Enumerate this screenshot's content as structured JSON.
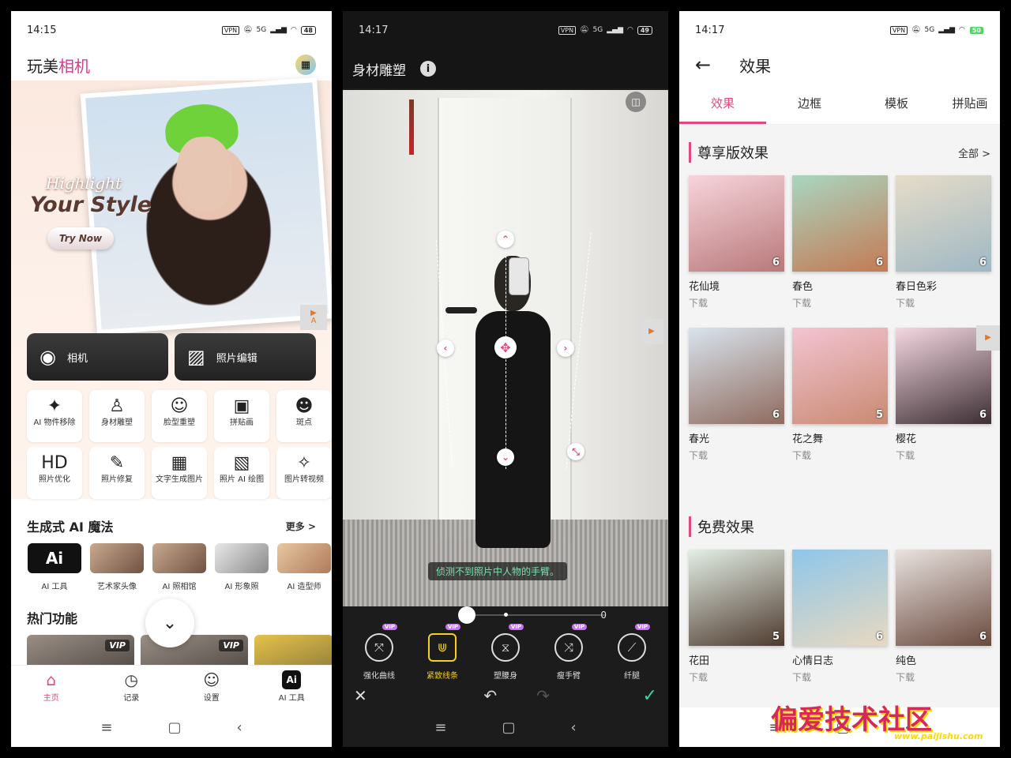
{
  "screen1": {
    "status": {
      "time": "14:15",
      "vpn": "VPN",
      "net": "5G",
      "battery": "48"
    },
    "app_title_a": "玩美",
    "app_title_b": "相机",
    "hero": {
      "line1": "Highlight",
      "line2": "Your Style",
      "cta": "Try Now",
      "side_badge": "A"
    },
    "big_buttons": [
      {
        "label": "相机",
        "icon": "camera-icon"
      },
      {
        "label": "照片编辑",
        "icon": "image-icon"
      }
    ],
    "tools": [
      {
        "label": "AI 物件移除",
        "icon": "eraser-icon",
        "glyph": "✦"
      },
      {
        "label": "身材雕塑",
        "icon": "body-icon",
        "glyph": "♙"
      },
      {
        "label": "脸型重塑",
        "icon": "face-icon",
        "glyph": "☺"
      },
      {
        "label": "拼贴画",
        "icon": "collage-icon",
        "glyph": "▣"
      },
      {
        "label": "斑点",
        "icon": "spot-icon",
        "glyph": "☻"
      },
      {
        "label": "照片优化",
        "icon": "hd-icon",
        "glyph": "HD"
      },
      {
        "label": "照片修复",
        "icon": "repair-icon",
        "glyph": "✎"
      },
      {
        "label": "文字生成图片",
        "icon": "text-to-image-icon",
        "glyph": "▦"
      },
      {
        "label": "照片 AI 绘图",
        "icon": "ai-draw-icon",
        "glyph": "▧"
      },
      {
        "label": "图片转视频",
        "icon": "photo-to-video-icon",
        "glyph": "✧"
      }
    ],
    "magic": {
      "title": "生成式 AI 魔法",
      "more": "更多 >",
      "items": [
        {
          "label": "AI 工具",
          "thumb": "Ai"
        },
        {
          "label": "艺术家头像",
          "thumb": ""
        },
        {
          "label": "AI 照相馆",
          "thumb": ""
        },
        {
          "label": "AI 形象照",
          "thumb": ""
        },
        {
          "label": "AI 造型师",
          "thumb": ""
        }
      ]
    },
    "hot": {
      "title": "热门功能",
      "vip": "VIP"
    },
    "tabs": [
      {
        "label": "主页",
        "glyph": "⌂"
      },
      {
        "label": "记录",
        "glyph": "◷"
      },
      {
        "label": "设置",
        "glyph": "☺"
      },
      {
        "label": "AI 工具",
        "glyph": "Ai"
      }
    ]
  },
  "screen2": {
    "status": {
      "time": "14:17",
      "vpn": "VPN",
      "net": "5G",
      "battery": "49"
    },
    "title": "身材雕塑",
    "toast": "侦测不到照片中人物的手臂。",
    "slider_value": "0",
    "tools": [
      {
        "label": "强化曲线",
        "glyph": "⤧",
        "vip": "VIP"
      },
      {
        "label": "紧致线条",
        "glyph": "⋓",
        "vip": "VIP"
      },
      {
        "label": "塑腰身",
        "glyph": "⧖",
        "vip": "VIP"
      },
      {
        "label": "瘦手臂",
        "glyph": "⤨",
        "vip": "VIP"
      },
      {
        "label": "纤腿",
        "glyph": "⟋",
        "vip": "VIP"
      }
    ],
    "accent": "#f4d020"
  },
  "screen3": {
    "status": {
      "time": "14:17",
      "vpn": "VPN",
      "net": "5G",
      "battery": "50"
    },
    "title": "效果",
    "tabs": [
      "效果",
      "边框",
      "模板",
      "拼贴画"
    ],
    "premium": {
      "title": "尊享版效果",
      "all": "全部 >",
      "items": [
        {
          "name": "花仙境",
          "sub": "下载",
          "count": "6"
        },
        {
          "name": "春色",
          "sub": "下载",
          "count": "6"
        },
        {
          "name": "春日色彩",
          "sub": "下载",
          "count": "6"
        },
        {
          "name": "春光",
          "sub": "下载",
          "count": "6"
        },
        {
          "name": "花之舞",
          "sub": "下载",
          "count": "5"
        },
        {
          "name": "樱花",
          "sub": "下载",
          "count": "6"
        }
      ]
    },
    "free": {
      "title": "免费效果",
      "items": [
        {
          "name": "花田",
          "sub": "下载",
          "count": "5"
        },
        {
          "name": "心情日志",
          "sub": "下载",
          "count": "6"
        },
        {
          "name": "纯色",
          "sub": "下载",
          "count": "6"
        }
      ]
    }
  },
  "watermark": {
    "text": "偏爱技术社区",
    "url": "www.paijishu.com"
  }
}
